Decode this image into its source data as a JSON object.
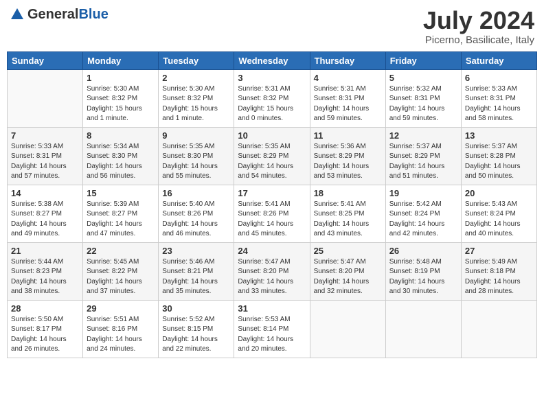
{
  "logo": {
    "general": "General",
    "blue": "Blue"
  },
  "title": "July 2024",
  "location": "Picerno, Basilicate, Italy",
  "days_of_week": [
    "Sunday",
    "Monday",
    "Tuesday",
    "Wednesday",
    "Thursday",
    "Friday",
    "Saturday"
  ],
  "weeks": [
    [
      {
        "day": "",
        "info": ""
      },
      {
        "day": "1",
        "info": "Sunrise: 5:30 AM\nSunset: 8:32 PM\nDaylight: 15 hours\nand 1 minute."
      },
      {
        "day": "2",
        "info": "Sunrise: 5:30 AM\nSunset: 8:32 PM\nDaylight: 15 hours\nand 1 minute."
      },
      {
        "day": "3",
        "info": "Sunrise: 5:31 AM\nSunset: 8:32 PM\nDaylight: 15 hours\nand 0 minutes."
      },
      {
        "day": "4",
        "info": "Sunrise: 5:31 AM\nSunset: 8:31 PM\nDaylight: 14 hours\nand 59 minutes."
      },
      {
        "day": "5",
        "info": "Sunrise: 5:32 AM\nSunset: 8:31 PM\nDaylight: 14 hours\nand 59 minutes."
      },
      {
        "day": "6",
        "info": "Sunrise: 5:33 AM\nSunset: 8:31 PM\nDaylight: 14 hours\nand 58 minutes."
      }
    ],
    [
      {
        "day": "7",
        "info": "Sunrise: 5:33 AM\nSunset: 8:31 PM\nDaylight: 14 hours\nand 57 minutes."
      },
      {
        "day": "8",
        "info": "Sunrise: 5:34 AM\nSunset: 8:30 PM\nDaylight: 14 hours\nand 56 minutes."
      },
      {
        "day": "9",
        "info": "Sunrise: 5:35 AM\nSunset: 8:30 PM\nDaylight: 14 hours\nand 55 minutes."
      },
      {
        "day": "10",
        "info": "Sunrise: 5:35 AM\nSunset: 8:29 PM\nDaylight: 14 hours\nand 54 minutes."
      },
      {
        "day": "11",
        "info": "Sunrise: 5:36 AM\nSunset: 8:29 PM\nDaylight: 14 hours\nand 53 minutes."
      },
      {
        "day": "12",
        "info": "Sunrise: 5:37 AM\nSunset: 8:29 PM\nDaylight: 14 hours\nand 51 minutes."
      },
      {
        "day": "13",
        "info": "Sunrise: 5:37 AM\nSunset: 8:28 PM\nDaylight: 14 hours\nand 50 minutes."
      }
    ],
    [
      {
        "day": "14",
        "info": "Sunrise: 5:38 AM\nSunset: 8:27 PM\nDaylight: 14 hours\nand 49 minutes."
      },
      {
        "day": "15",
        "info": "Sunrise: 5:39 AM\nSunset: 8:27 PM\nDaylight: 14 hours\nand 47 minutes."
      },
      {
        "day": "16",
        "info": "Sunrise: 5:40 AM\nSunset: 8:26 PM\nDaylight: 14 hours\nand 46 minutes."
      },
      {
        "day": "17",
        "info": "Sunrise: 5:41 AM\nSunset: 8:26 PM\nDaylight: 14 hours\nand 45 minutes."
      },
      {
        "day": "18",
        "info": "Sunrise: 5:41 AM\nSunset: 8:25 PM\nDaylight: 14 hours\nand 43 minutes."
      },
      {
        "day": "19",
        "info": "Sunrise: 5:42 AM\nSunset: 8:24 PM\nDaylight: 14 hours\nand 42 minutes."
      },
      {
        "day": "20",
        "info": "Sunrise: 5:43 AM\nSunset: 8:24 PM\nDaylight: 14 hours\nand 40 minutes."
      }
    ],
    [
      {
        "day": "21",
        "info": "Sunrise: 5:44 AM\nSunset: 8:23 PM\nDaylight: 14 hours\nand 38 minutes."
      },
      {
        "day": "22",
        "info": "Sunrise: 5:45 AM\nSunset: 8:22 PM\nDaylight: 14 hours\nand 37 minutes."
      },
      {
        "day": "23",
        "info": "Sunrise: 5:46 AM\nSunset: 8:21 PM\nDaylight: 14 hours\nand 35 minutes."
      },
      {
        "day": "24",
        "info": "Sunrise: 5:47 AM\nSunset: 8:20 PM\nDaylight: 14 hours\nand 33 minutes."
      },
      {
        "day": "25",
        "info": "Sunrise: 5:47 AM\nSunset: 8:20 PM\nDaylight: 14 hours\nand 32 minutes."
      },
      {
        "day": "26",
        "info": "Sunrise: 5:48 AM\nSunset: 8:19 PM\nDaylight: 14 hours\nand 30 minutes."
      },
      {
        "day": "27",
        "info": "Sunrise: 5:49 AM\nSunset: 8:18 PM\nDaylight: 14 hours\nand 28 minutes."
      }
    ],
    [
      {
        "day": "28",
        "info": "Sunrise: 5:50 AM\nSunset: 8:17 PM\nDaylight: 14 hours\nand 26 minutes."
      },
      {
        "day": "29",
        "info": "Sunrise: 5:51 AM\nSunset: 8:16 PM\nDaylight: 14 hours\nand 24 minutes."
      },
      {
        "day": "30",
        "info": "Sunrise: 5:52 AM\nSunset: 8:15 PM\nDaylight: 14 hours\nand 22 minutes."
      },
      {
        "day": "31",
        "info": "Sunrise: 5:53 AM\nSunset: 8:14 PM\nDaylight: 14 hours\nand 20 minutes."
      },
      {
        "day": "",
        "info": ""
      },
      {
        "day": "",
        "info": ""
      },
      {
        "day": "",
        "info": ""
      }
    ]
  ]
}
